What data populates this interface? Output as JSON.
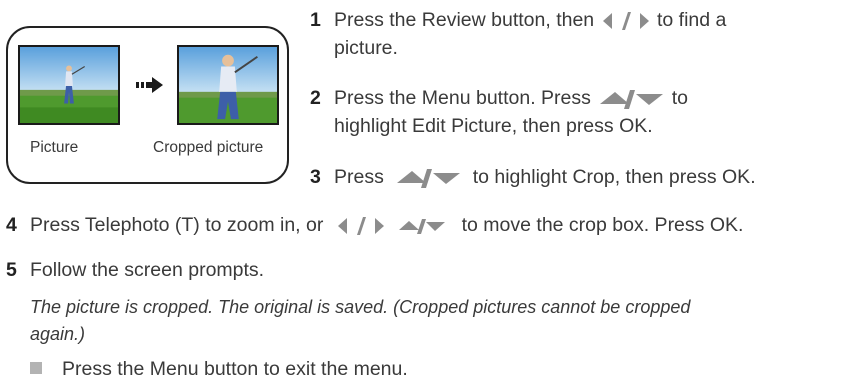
{
  "figure": {
    "caption_original": "Picture",
    "caption_cropped": "Cropped picture"
  },
  "steps": [
    {
      "number": "1",
      "part_a": "Press the Review button, then",
      "icon_a": "left-right-arrows-icon",
      "part_b": "to find a",
      "line2": "picture."
    },
    {
      "number": "2",
      "part_a": "Press the Menu button. Press",
      "icon_a": "up-down-arrows-icon",
      "part_b": "to",
      "line2": "highlight Edit Picture, then press OK."
    },
    {
      "number": "3",
      "part_a": "Press",
      "icon_a": "up-down-arrows-icon",
      "part_b": "to highlight Crop, then press OK."
    },
    {
      "number": "4",
      "part_a": "Press Telephoto (T) to zoom in, or",
      "icon_a": "left-right-arrows-icon",
      "icon_b": "up-down-arrows-icon",
      "part_b": "to move the crop box. Press OK."
    },
    {
      "number": "5",
      "part_a": "Follow the screen prompts."
    }
  ],
  "note": {
    "line1": "The picture is cropped. The original is saved. (Cropped pictures cannot be cropped",
    "line2": "again.)"
  },
  "bullet": {
    "text": "Press the Menu button to exit the menu.",
    "icon": "square-bullet-icon"
  },
  "colors": {
    "text": "#3a3a3a",
    "glyph": "#8c8c8c",
    "sky": "#7fb8e6",
    "grass": "#4f9a2e"
  }
}
